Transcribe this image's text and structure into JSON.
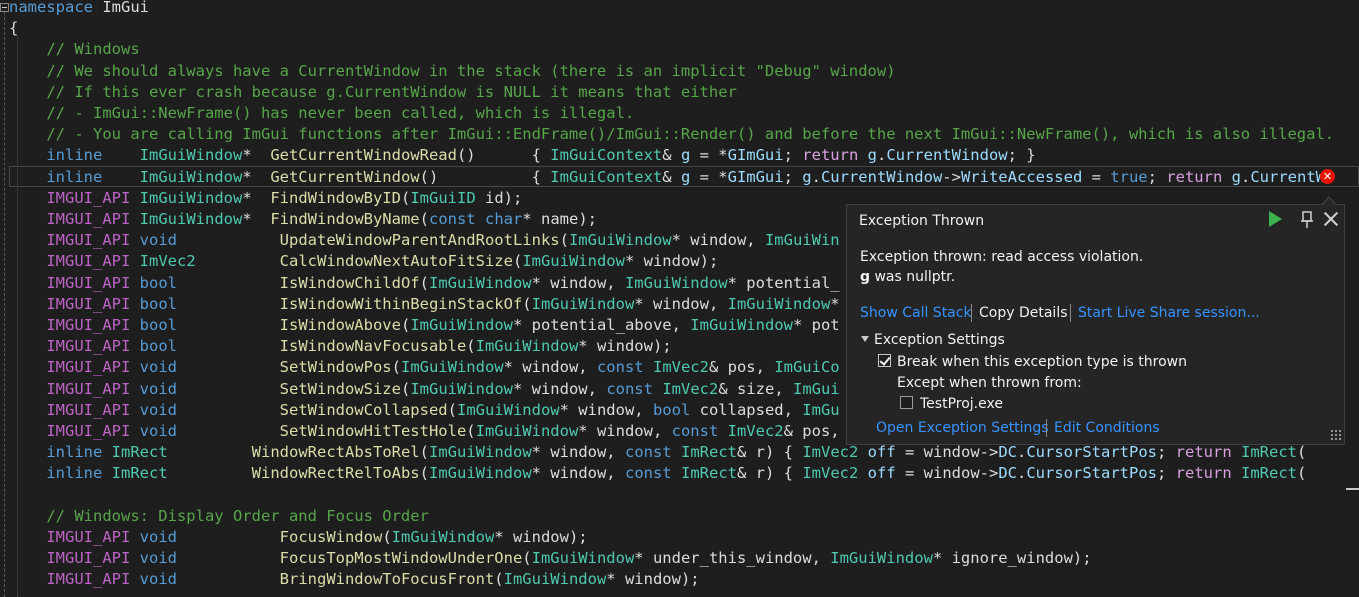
{
  "editor": {
    "lines": [
      [
        {
          "t": "namespace",
          "c": "kw"
        },
        {
          "t": " ImGui",
          "c": "pl"
        }
      ],
      [
        {
          "t": "{",
          "c": "pl"
        }
      ],
      [
        {
          "t": "    // Windows",
          "c": "cm"
        }
      ],
      [
        {
          "t": "    // We should always have a CurrentWindow in the stack (there is an implicit \"Debug\" window)",
          "c": "cm"
        }
      ],
      [
        {
          "t": "    // If this ever crash because g.CurrentWindow is NULL it means that either",
          "c": "cm"
        }
      ],
      [
        {
          "t": "    // - ImGui::NewFrame() has never been called, which is illegal.",
          "c": "cm"
        }
      ],
      [
        {
          "t": "    // - You are calling ImGui functions after ImGui::EndFrame()/ImGui::Render() and before the next ImGui::NewFrame(), which is also illegal.",
          "c": "cm"
        }
      ],
      [
        {
          "t": "    inline",
          "c": "kw"
        },
        {
          "t": "    ",
          "c": "pl"
        },
        {
          "t": "ImGuiWindow",
          "c": "ty"
        },
        {
          "t": "*  ",
          "c": "pl"
        },
        {
          "t": "GetCurrentWindowRead",
          "c": "fn"
        },
        {
          "t": "()      { ",
          "c": "pl"
        },
        {
          "t": "ImGuiContext",
          "c": "ty"
        },
        {
          "t": "& ",
          "c": "pl"
        },
        {
          "t": "g",
          "c": "pa"
        },
        {
          "t": " = *",
          "c": "pl"
        },
        {
          "t": "GImGui",
          "c": "pa"
        },
        {
          "t": "; ",
          "c": "pl"
        },
        {
          "t": "return",
          "c": "ctl"
        },
        {
          "t": " ",
          "c": "pl"
        },
        {
          "t": "g",
          "c": "pa"
        },
        {
          "t": ".",
          "c": "pl"
        },
        {
          "t": "CurrentWindow",
          "c": "pa"
        },
        {
          "t": "; }",
          "c": "pl"
        }
      ],
      [
        {
          "t": "    inline",
          "c": "kw"
        },
        {
          "t": "    ",
          "c": "pl"
        },
        {
          "t": "ImGuiWindow",
          "c": "ty"
        },
        {
          "t": "*  ",
          "c": "pl"
        },
        {
          "t": "GetCurrentWindow",
          "c": "fn"
        },
        {
          "t": "()          { ",
          "c": "pl"
        },
        {
          "t": "ImGuiContext",
          "c": "ty"
        },
        {
          "t": "& ",
          "c": "pl"
        },
        {
          "t": "g",
          "c": "pa"
        },
        {
          "t": " = *",
          "c": "pl"
        },
        {
          "t": "GImGui",
          "c": "pa"
        },
        {
          "t": "; ",
          "c": "pl"
        },
        {
          "t": "g",
          "c": "pa"
        },
        {
          "t": ".",
          "c": "pl"
        },
        {
          "t": "CurrentWindow",
          "c": "pa"
        },
        {
          "t": "->",
          "c": "pl"
        },
        {
          "t": "WriteAccessed",
          "c": "pa"
        },
        {
          "t": " = ",
          "c": "pl"
        },
        {
          "t": "true",
          "c": "kw"
        },
        {
          "t": "; ",
          "c": "pl"
        },
        {
          "t": "return",
          "c": "ctl"
        },
        {
          "t": " ",
          "c": "pl"
        },
        {
          "t": "g",
          "c": "pa"
        },
        {
          "t": ".",
          "c": "pl"
        },
        {
          "t": "CurrentW",
          "c": "pa"
        }
      ],
      [
        {
          "t": "    IMGUI_API",
          "c": "mc"
        },
        {
          "t": " ",
          "c": "pl"
        },
        {
          "t": "ImGuiWindow",
          "c": "ty"
        },
        {
          "t": "*  ",
          "c": "pl"
        },
        {
          "t": "FindWindowByID",
          "c": "fn"
        },
        {
          "t": "(",
          "c": "pl"
        },
        {
          "t": "ImGuiID",
          "c": "ty"
        },
        {
          "t": " id);",
          "c": "pl"
        }
      ],
      [
        {
          "t": "    IMGUI_API",
          "c": "mc"
        },
        {
          "t": " ",
          "c": "pl"
        },
        {
          "t": "ImGuiWindow",
          "c": "ty"
        },
        {
          "t": "*  ",
          "c": "pl"
        },
        {
          "t": "FindWindowByName",
          "c": "fn"
        },
        {
          "t": "(",
          "c": "pl"
        },
        {
          "t": "const",
          "c": "kw"
        },
        {
          "t": " ",
          "c": "pl"
        },
        {
          "t": "char",
          "c": "kw"
        },
        {
          "t": "* name);",
          "c": "pl"
        }
      ],
      [
        {
          "t": "    IMGUI_API",
          "c": "mc"
        },
        {
          "t": " ",
          "c": "pl"
        },
        {
          "t": "void",
          "c": "kw"
        },
        {
          "t": "           ",
          "c": "pl"
        },
        {
          "t": "UpdateWindowParentAndRootLinks",
          "c": "fn"
        },
        {
          "t": "(",
          "c": "pl"
        },
        {
          "t": "ImGuiWindow",
          "c": "ty"
        },
        {
          "t": "* window, ",
          "c": "pl"
        },
        {
          "t": "ImGuiWin",
          "c": "ty"
        }
      ],
      [
        {
          "t": "    IMGUI_API",
          "c": "mc"
        },
        {
          "t": " ",
          "c": "pl"
        },
        {
          "t": "ImVec2",
          "c": "ty"
        },
        {
          "t": "         ",
          "c": "pl"
        },
        {
          "t": "CalcWindowNextAutoFitSize",
          "c": "fn"
        },
        {
          "t": "(",
          "c": "pl"
        },
        {
          "t": "ImGuiWindow",
          "c": "ty"
        },
        {
          "t": "* window);",
          "c": "pl"
        }
      ],
      [
        {
          "t": "    IMGUI_API",
          "c": "mc"
        },
        {
          "t": " ",
          "c": "pl"
        },
        {
          "t": "bool",
          "c": "kw"
        },
        {
          "t": "           ",
          "c": "pl"
        },
        {
          "t": "IsWindowChildOf",
          "c": "fn"
        },
        {
          "t": "(",
          "c": "pl"
        },
        {
          "t": "ImGuiWindow",
          "c": "ty"
        },
        {
          "t": "* window, ",
          "c": "pl"
        },
        {
          "t": "ImGuiWindow",
          "c": "ty"
        },
        {
          "t": "* potential_",
          "c": "pl"
        }
      ],
      [
        {
          "t": "    IMGUI_API",
          "c": "mc"
        },
        {
          "t": " ",
          "c": "pl"
        },
        {
          "t": "bool",
          "c": "kw"
        },
        {
          "t": "           ",
          "c": "pl"
        },
        {
          "t": "IsWindowWithinBeginStackOf",
          "c": "fn"
        },
        {
          "t": "(",
          "c": "pl"
        },
        {
          "t": "ImGuiWindow",
          "c": "ty"
        },
        {
          "t": "* window, ",
          "c": "pl"
        },
        {
          "t": "ImGuiWindow",
          "c": "ty"
        },
        {
          "t": "*",
          "c": "pl"
        }
      ],
      [
        {
          "t": "    IMGUI_API",
          "c": "mc"
        },
        {
          "t": " ",
          "c": "pl"
        },
        {
          "t": "bool",
          "c": "kw"
        },
        {
          "t": "           ",
          "c": "pl"
        },
        {
          "t": "IsWindowAbove",
          "c": "fn"
        },
        {
          "t": "(",
          "c": "pl"
        },
        {
          "t": "ImGuiWindow",
          "c": "ty"
        },
        {
          "t": "* potential_above, ",
          "c": "pl"
        },
        {
          "t": "ImGuiWindow",
          "c": "ty"
        },
        {
          "t": "* pot",
          "c": "pl"
        }
      ],
      [
        {
          "t": "    IMGUI_API",
          "c": "mc"
        },
        {
          "t": " ",
          "c": "pl"
        },
        {
          "t": "bool",
          "c": "kw"
        },
        {
          "t": "           ",
          "c": "pl"
        },
        {
          "t": "IsWindowNavFocusable",
          "c": "fn"
        },
        {
          "t": "(",
          "c": "pl"
        },
        {
          "t": "ImGuiWindow",
          "c": "ty"
        },
        {
          "t": "* window);",
          "c": "pl"
        }
      ],
      [
        {
          "t": "    IMGUI_API",
          "c": "mc"
        },
        {
          "t": " ",
          "c": "pl"
        },
        {
          "t": "void",
          "c": "kw"
        },
        {
          "t": "           ",
          "c": "pl"
        },
        {
          "t": "SetWindowPos",
          "c": "fn"
        },
        {
          "t": "(",
          "c": "pl"
        },
        {
          "t": "ImGuiWindow",
          "c": "ty"
        },
        {
          "t": "* window, ",
          "c": "pl"
        },
        {
          "t": "const",
          "c": "kw"
        },
        {
          "t": " ",
          "c": "pl"
        },
        {
          "t": "ImVec2",
          "c": "ty"
        },
        {
          "t": "& pos, ",
          "c": "pl"
        },
        {
          "t": "ImGuiCo",
          "c": "ty"
        }
      ],
      [
        {
          "t": "    IMGUI_API",
          "c": "mc"
        },
        {
          "t": " ",
          "c": "pl"
        },
        {
          "t": "void",
          "c": "kw"
        },
        {
          "t": "           ",
          "c": "pl"
        },
        {
          "t": "SetWindowSize",
          "c": "fn"
        },
        {
          "t": "(",
          "c": "pl"
        },
        {
          "t": "ImGuiWindow",
          "c": "ty"
        },
        {
          "t": "* window, ",
          "c": "pl"
        },
        {
          "t": "const",
          "c": "kw"
        },
        {
          "t": " ",
          "c": "pl"
        },
        {
          "t": "ImVec2",
          "c": "ty"
        },
        {
          "t": "& size, ",
          "c": "pl"
        },
        {
          "t": "ImGui",
          "c": "ty"
        }
      ],
      [
        {
          "t": "    IMGUI_API",
          "c": "mc"
        },
        {
          "t": " ",
          "c": "pl"
        },
        {
          "t": "void",
          "c": "kw"
        },
        {
          "t": "           ",
          "c": "pl"
        },
        {
          "t": "SetWindowCollapsed",
          "c": "fn"
        },
        {
          "t": "(",
          "c": "pl"
        },
        {
          "t": "ImGuiWindow",
          "c": "ty"
        },
        {
          "t": "* window, ",
          "c": "pl"
        },
        {
          "t": "bool",
          "c": "kw"
        },
        {
          "t": " collapsed, ",
          "c": "pl"
        },
        {
          "t": "ImGu",
          "c": "ty"
        }
      ],
      [
        {
          "t": "    IMGUI_API",
          "c": "mc"
        },
        {
          "t": " ",
          "c": "pl"
        },
        {
          "t": "void",
          "c": "kw"
        },
        {
          "t": "           ",
          "c": "pl"
        },
        {
          "t": "SetWindowHitTestHole",
          "c": "fn"
        },
        {
          "t": "(",
          "c": "pl"
        },
        {
          "t": "ImGuiWindow",
          "c": "ty"
        },
        {
          "t": "* window, ",
          "c": "pl"
        },
        {
          "t": "const",
          "c": "kw"
        },
        {
          "t": " ",
          "c": "pl"
        },
        {
          "t": "ImVec2",
          "c": "ty"
        },
        {
          "t": "& pos,",
          "c": "pl"
        }
      ],
      [
        {
          "t": "    inline",
          "c": "kw"
        },
        {
          "t": " ",
          "c": "pl"
        },
        {
          "t": "ImRect",
          "c": "ty"
        },
        {
          "t": "         ",
          "c": "pl"
        },
        {
          "t": "WindowRectAbsToRel",
          "c": "fn"
        },
        {
          "t": "(",
          "c": "pl"
        },
        {
          "t": "ImGuiWindow",
          "c": "ty"
        },
        {
          "t": "* window, ",
          "c": "pl"
        },
        {
          "t": "const",
          "c": "kw"
        },
        {
          "t": " ",
          "c": "pl"
        },
        {
          "t": "ImRect",
          "c": "ty"
        },
        {
          "t": "& r) { ",
          "c": "pl"
        },
        {
          "t": "ImVec2",
          "c": "ty"
        },
        {
          "t": " ",
          "c": "pl"
        },
        {
          "t": "off",
          "c": "pa"
        },
        {
          "t": " = window->",
          "c": "pl"
        },
        {
          "t": "DC",
          "c": "pa"
        },
        {
          "t": ".",
          "c": "pl"
        },
        {
          "t": "CursorStartPos",
          "c": "pa"
        },
        {
          "t": "; ",
          "c": "pl"
        },
        {
          "t": "return",
          "c": "ctl"
        },
        {
          "t": " ",
          "c": "pl"
        },
        {
          "t": "ImRect",
          "c": "ty"
        },
        {
          "t": "(",
          "c": "pl"
        }
      ],
      [
        {
          "t": "    inline",
          "c": "kw"
        },
        {
          "t": " ",
          "c": "pl"
        },
        {
          "t": "ImRect",
          "c": "ty"
        },
        {
          "t": "         ",
          "c": "pl"
        },
        {
          "t": "WindowRectRelToAbs",
          "c": "fn"
        },
        {
          "t": "(",
          "c": "pl"
        },
        {
          "t": "ImGuiWindow",
          "c": "ty"
        },
        {
          "t": "* window, ",
          "c": "pl"
        },
        {
          "t": "const",
          "c": "kw"
        },
        {
          "t": " ",
          "c": "pl"
        },
        {
          "t": "ImRect",
          "c": "ty"
        },
        {
          "t": "& r) { ",
          "c": "pl"
        },
        {
          "t": "ImVec2",
          "c": "ty"
        },
        {
          "t": " ",
          "c": "pl"
        },
        {
          "t": "off",
          "c": "pa"
        },
        {
          "t": " = window->",
          "c": "pl"
        },
        {
          "t": "DC",
          "c": "pa"
        },
        {
          "t": ".",
          "c": "pl"
        },
        {
          "t": "CursorStartPos",
          "c": "pa"
        },
        {
          "t": "; ",
          "c": "pl"
        },
        {
          "t": "return",
          "c": "ctl"
        },
        {
          "t": " ",
          "c": "pl"
        },
        {
          "t": "ImRect",
          "c": "ty"
        },
        {
          "t": "(",
          "c": "pl"
        }
      ],
      [],
      [
        {
          "t": "    // Windows: Display Order and Focus Order",
          "c": "cm"
        }
      ],
      [
        {
          "t": "    IMGUI_API",
          "c": "mc"
        },
        {
          "t": " ",
          "c": "pl"
        },
        {
          "t": "void",
          "c": "kw"
        },
        {
          "t": "           ",
          "c": "pl"
        },
        {
          "t": "FocusWindow",
          "c": "fn"
        },
        {
          "t": "(",
          "c": "pl"
        },
        {
          "t": "ImGuiWindow",
          "c": "ty"
        },
        {
          "t": "* window);",
          "c": "pl"
        }
      ],
      [
        {
          "t": "    IMGUI_API",
          "c": "mc"
        },
        {
          "t": " ",
          "c": "pl"
        },
        {
          "t": "void",
          "c": "kw"
        },
        {
          "t": "           ",
          "c": "pl"
        },
        {
          "t": "FocusTopMostWindowUnderOne",
          "c": "fn"
        },
        {
          "t": "(",
          "c": "pl"
        },
        {
          "t": "ImGuiWindow",
          "c": "ty"
        },
        {
          "t": "* under_this_window, ",
          "c": "pl"
        },
        {
          "t": "ImGuiWindow",
          "c": "ty"
        },
        {
          "t": "* ignore_window);",
          "c": "pl"
        }
      ],
      [
        {
          "t": "    IMGUI_API",
          "c": "mc"
        },
        {
          "t": " ",
          "c": "pl"
        },
        {
          "t": "void",
          "c": "kw"
        },
        {
          "t": "           ",
          "c": "pl"
        },
        {
          "t": "BringWindowToFocusFront",
          "c": "fn"
        },
        {
          "t": "(",
          "c": "pl"
        },
        {
          "t": "ImGuiWindow",
          "c": "ty"
        },
        {
          "t": "* window);",
          "c": "pl"
        }
      ]
    ]
  },
  "colors": {
    "keyword": "#569cd6",
    "type": "#4ec9b0",
    "function": "#dcdcaa",
    "identifier": "#9cdcfe",
    "comment": "#57a64a",
    "macro": "#bd63c5",
    "control": "#d8a0df",
    "error": "#e51400",
    "link": "#3794ff"
  },
  "exception_popup": {
    "title": "Exception Thrown",
    "message_line1": "Exception thrown: read access violation.",
    "message_var": "g",
    "message_line2_rest": " was nullptr.",
    "links": {
      "show_call_stack": "Show Call Stack",
      "copy_details": "Copy Details",
      "live_share": "Start Live Share session..."
    },
    "settings_header": "Exception Settings",
    "break_when_thrown": "Break when this exception type is thrown",
    "break_when_thrown_checked": true,
    "except_when_thrown_from": "Except when thrown from:",
    "module_name": "TestProj.exe",
    "module_checked": false,
    "open_settings": "Open Exception Settings",
    "edit_conditions": "Edit Conditions",
    "icons": [
      "continue-icon",
      "pin-icon",
      "close-icon",
      "error-icon"
    ]
  }
}
